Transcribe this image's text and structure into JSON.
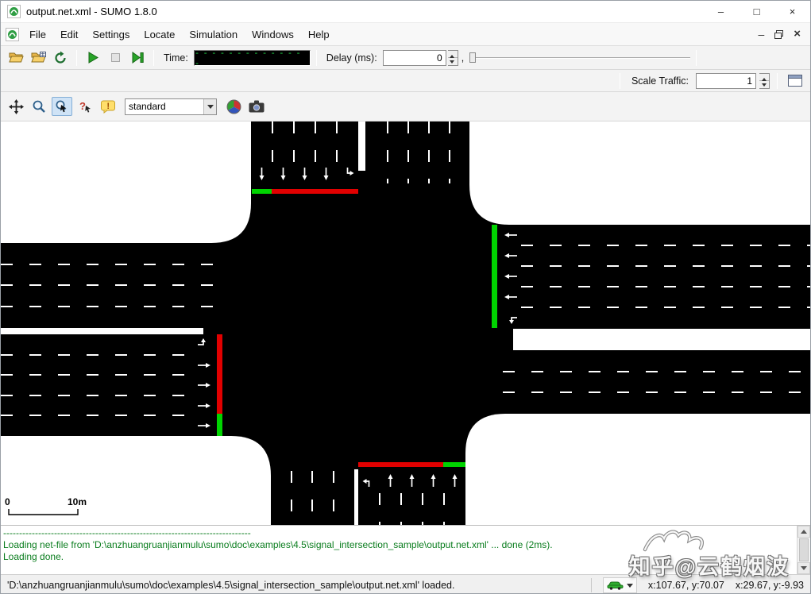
{
  "window": {
    "title": "output.net.xml - SUMO 1.8.0",
    "minimize_glyph": "–",
    "maximize_glyph": "□",
    "close_glyph": "×"
  },
  "menubar": {
    "items": [
      "File",
      "Edit",
      "Settings",
      "Locate",
      "Simulation",
      "Windows",
      "Help"
    ],
    "minimize_glyph": "–",
    "close_glyph": "×"
  },
  "sim_toolbar": {
    "time_label": "Time:",
    "time_display": "--------------",
    "delay_label": "Delay (ms):",
    "delay_value": "0",
    "comma": ","
  },
  "scale_toolbar": {
    "scale_label": "Scale Traffic:",
    "scale_value": "1"
  },
  "view_toolbar": {
    "scheme": "standard"
  },
  "canvas": {
    "ruler_start": "0",
    "ruler_end": "10m",
    "signal_green": "#00d400",
    "signal_red": "#e10000",
    "road_color": "#000000",
    "lane_marking_color": "#ffffff"
  },
  "log": {
    "text_color": "#0a7d1e",
    "lines": [
      "------------------------------------------------------------------------------",
      "Loading net-file from 'D:\\anzhuangruanjianmulu\\sumo\\doc\\examples\\4.5\\signal_intersection_sample\\output.net.xml' ... done (2ms).",
      "Loading done."
    ]
  },
  "status": {
    "message": "'D:\\anzhuangruanjianmulu\\sumo\\doc\\examples\\4.5\\signal_intersection_sample\\output.net.xml' loaded.",
    "cursor_geo": "x:107.67, y:70.07",
    "cursor_net": "x:29.67, y:-9.93"
  },
  "watermark": "知乎@云鹤烟波"
}
